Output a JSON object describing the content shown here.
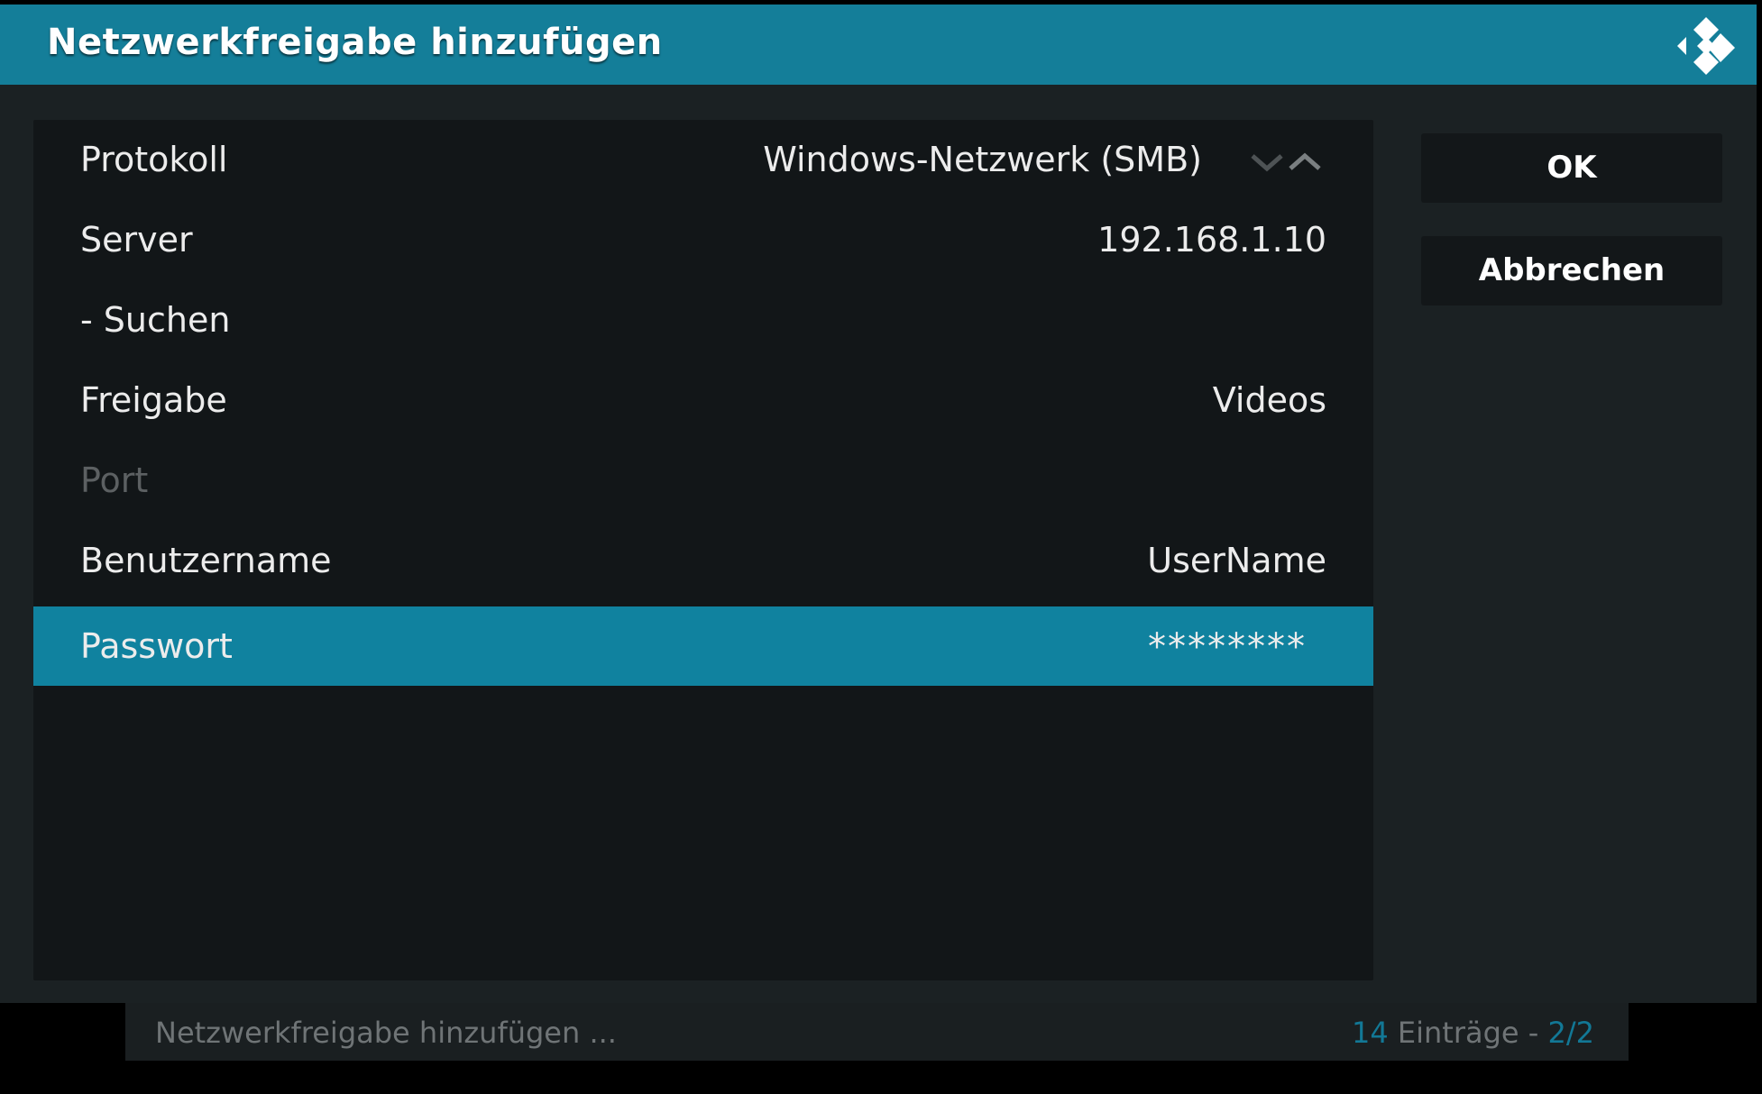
{
  "header": {
    "title": "Netzwerkfreigabe hinzufügen",
    "logo_icon": "kodi-logo-icon"
  },
  "colors": {
    "header_bg": "#147e99",
    "selected_row_bg": "#10829f",
    "accent_text": "#127896"
  },
  "settings": [
    {
      "label": "Protokoll",
      "value": "Windows-Netzwerk (SMB)"
    },
    {
      "label": "Server",
      "value": "192.168.1.10"
    },
    {
      "label": "- Suchen",
      "value": ""
    },
    {
      "label": "Freigabe",
      "value": "Videos"
    },
    {
      "label": "Port",
      "value": ""
    },
    {
      "label": "Benutzername",
      "value": "UserName"
    },
    {
      "label": "Passwort",
      "value": "********"
    }
  ],
  "buttons": {
    "ok": "OK",
    "cancel": "Abbrechen"
  },
  "footer": {
    "left_text": "Netzwerkfreigabe hinzufügen ...",
    "count": "14",
    "count_label": " Einträge - ",
    "page": "2/2"
  }
}
